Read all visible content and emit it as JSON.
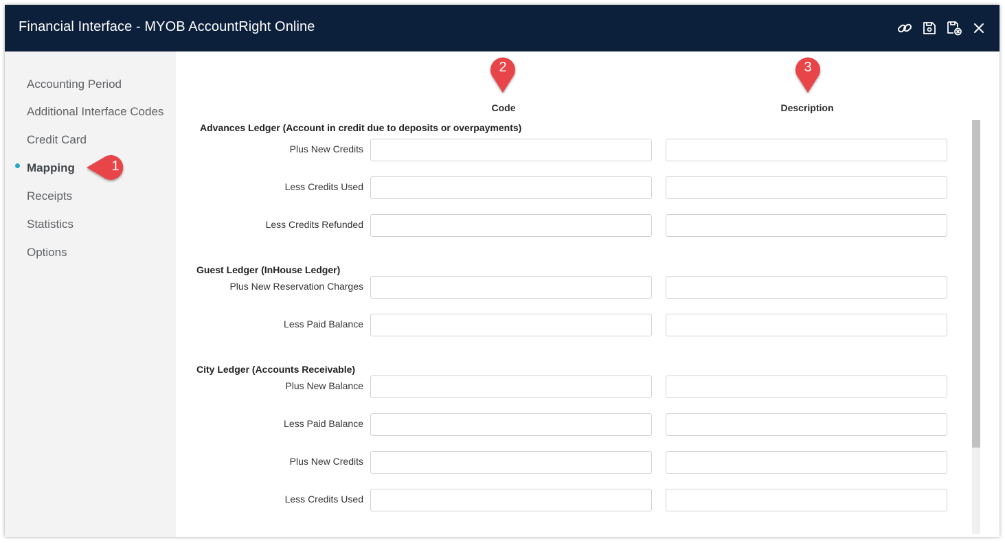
{
  "window": {
    "title": "Financial Interface - MYOB AccountRight Online",
    "icons": [
      "link-icon",
      "save-icon",
      "save-close-icon",
      "close-icon"
    ]
  },
  "sidebar": {
    "items": [
      {
        "label": "Accounting Period"
      },
      {
        "label": "Additional Interface Codes"
      },
      {
        "label": "Credit Card"
      },
      {
        "label": "Mapping",
        "active": true
      },
      {
        "label": "Receipts"
      },
      {
        "label": "Statistics"
      },
      {
        "label": "Options"
      }
    ]
  },
  "columns": {
    "code": "Code",
    "description": "Description"
  },
  "sections": [
    {
      "title": "Advances Ledger (Account in credit due to deposits or overpayments)",
      "rows": [
        {
          "label": "Plus New Credits",
          "code": "",
          "description": ""
        },
        {
          "label": "Less Credits Used",
          "code": "",
          "description": ""
        },
        {
          "label": "Less Credits Refunded",
          "code": "",
          "description": ""
        }
      ]
    },
    {
      "title": "Guest Ledger (InHouse Ledger)",
      "rows": [
        {
          "label": "Plus New Reservation Charges",
          "code": "",
          "description": ""
        },
        {
          "label": "Less Paid Balance",
          "code": "",
          "description": ""
        }
      ]
    },
    {
      "title": "City Ledger (Accounts Receivable)",
      "rows": [
        {
          "label": "Plus New Balance",
          "code": "",
          "description": ""
        },
        {
          "label": "Less Paid Balance",
          "code": "",
          "description": ""
        },
        {
          "label": "Plus New Credits",
          "code": "",
          "description": ""
        },
        {
          "label": "Less Credits Used",
          "code": "",
          "description": ""
        }
      ]
    }
  ],
  "callouts": [
    "1",
    "2",
    "3"
  ],
  "colors": {
    "titlebar": "#0c1f3b",
    "sidebar": "#f3f3f3",
    "active_dot": "#25a9c4",
    "callout": "#e8454a"
  }
}
